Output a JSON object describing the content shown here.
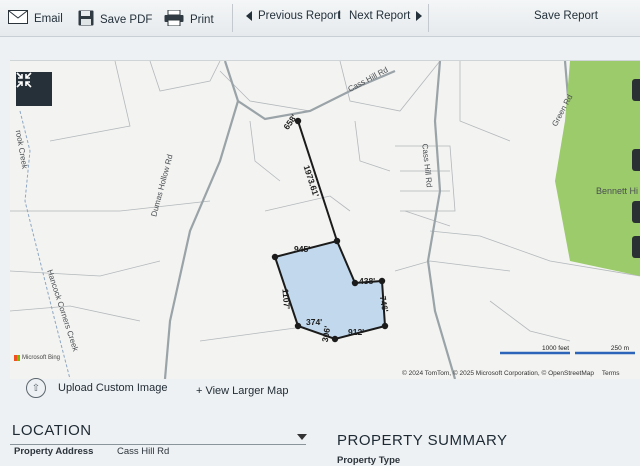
{
  "toolbar": {
    "email": "Email",
    "save_pdf": "Save PDF",
    "print": "Print",
    "previous": "Previous Report",
    "separator": "I",
    "next": "Next Report",
    "save_report": "Save Report"
  },
  "map": {
    "road_labels": {
      "cass_hill_rd": "Cass Hill Rd",
      "cass_hill_rd_2": "Cass Hill Rd",
      "brook_creek": "rook Creek",
      "dumas_hollow_rd": "Dumas Hollow Rd",
      "hancock_corners_creek": "Hancock Corners Creek",
      "green_rd": "Green Rd",
      "bennett_hill": "Bennett Hi"
    },
    "segment_labels": [
      "658'",
      "1973.61'",
      "945'",
      "438'",
      "1107'",
      "746'",
      "374'",
      "306'",
      "912'"
    ],
    "microsoft_bing": "Microsoft Bing",
    "attribution": "© 2024 TomTom, © 2025 Microsoft Corporation, © OpenStreetMap",
    "terms": "Terms",
    "scale_feet": "1000 feet",
    "scale_m": "250 m"
  },
  "actions": {
    "upload": "Upload Custom Image",
    "view_larger": "+ View Larger Map"
  },
  "location": {
    "title": "LOCATION",
    "property_address_label": "Property Address",
    "property_address_value": "Cass Hill Rd"
  },
  "summary": {
    "title": "PROPERTY SUMMARY",
    "property_type_label": "Property Type"
  },
  "colors": {
    "parcel_fill": "#b9d4ec",
    "parcel_line": "#1b1b1b",
    "park_green": "#9ccb6b",
    "road": "#9aa3a8",
    "scale_blue": "#2b64b8"
  }
}
